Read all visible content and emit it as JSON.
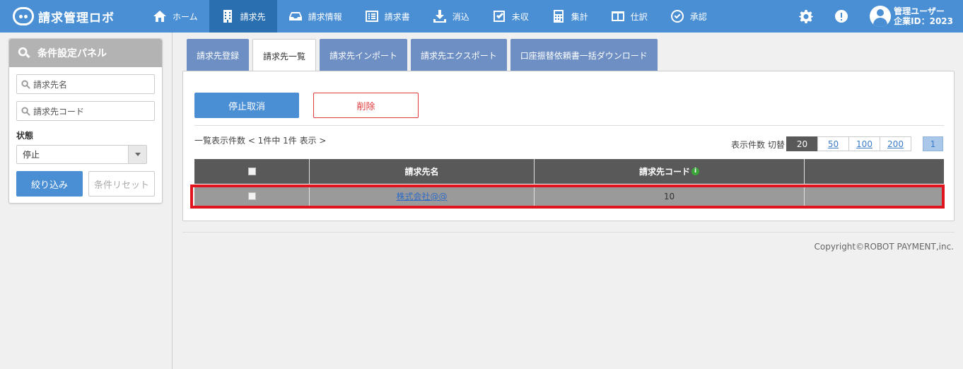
{
  "header": {
    "logo_text": "請求管理ロボ",
    "nav": [
      {
        "label": "ホーム",
        "icon": "home-icon"
      },
      {
        "label": "請求先",
        "icon": "building-icon",
        "active": true
      },
      {
        "label": "請求情報",
        "icon": "inbox-icon"
      },
      {
        "label": "請求書",
        "icon": "list-icon"
      },
      {
        "label": "消込",
        "icon": "download-icon"
      },
      {
        "label": "未収",
        "icon": "checkbox-icon"
      },
      {
        "label": "集計",
        "icon": "calculator-icon"
      },
      {
        "label": "仕訳",
        "icon": "columns-icon"
      },
      {
        "label": "承認",
        "icon": "check-circle-icon"
      }
    ],
    "user_line1": "管理ユーザー",
    "user_line2": "企業ID：2023"
  },
  "sidebar": {
    "title": "条件設定パネル",
    "name_placeholder": "請求先名",
    "code_placeholder": "請求先コード",
    "state_label": "状態",
    "state_value": "停止",
    "filter_button": "絞り込み",
    "reset_button": "条件リセット"
  },
  "tabs": [
    {
      "label": "請求先登録"
    },
    {
      "label": "請求先一覧",
      "active": true
    },
    {
      "label": "請求先インポート"
    },
    {
      "label": "請求先エクスポート"
    },
    {
      "label": "口座振替依頼書一括ダウンロード"
    }
  ],
  "main": {
    "stop_cancel_button": "停止取消",
    "delete_button": "削除",
    "summary": "一覧表示件数 < 1件中 1件 表示 >",
    "per_page_label": "表示件数 切替",
    "per_page_options": [
      "20",
      "50",
      "100",
      "200"
    ],
    "per_page_selected": "20",
    "page": "1",
    "table": {
      "headers": [
        "",
        "請求先名",
        "請求先コード",
        ""
      ],
      "rows": [
        {
          "name": "株式会社@@",
          "code": "10"
        }
      ]
    }
  },
  "footer": {
    "copyright": "Copyright©ROBOT PAYMENT,inc."
  },
  "colors": {
    "header": "#4a8fd4",
    "active_nav": "#2a6fb0",
    "tab": "#6d8fc4",
    "delete": "#e03a3a",
    "highlight": "#e0141e"
  }
}
